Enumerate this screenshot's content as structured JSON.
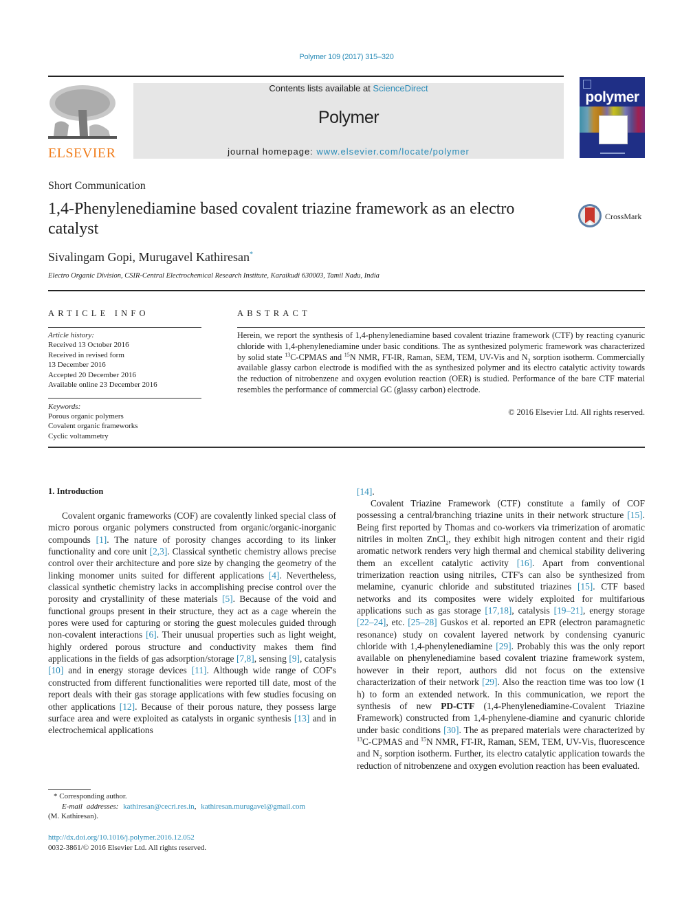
{
  "header": {
    "citation": "Polymer 109 (2017) 315–320",
    "contents_prefix": "Contents lists available at ",
    "contents_link": "ScienceDirect",
    "journal_name": "Polymer",
    "homepage_prefix": "journal homepage: ",
    "homepage_link": "www.elsevier.com/locate/polymer",
    "publisher_logo": "ELSEVIER",
    "cover_title": "polymer",
    "colors": {
      "link": "#2a8cb8",
      "elsevier_orange": "#f07c1a",
      "masthead_bg": "#e6e6e6",
      "cover_bg": "#1f2f86"
    }
  },
  "article": {
    "type": "Short Communication",
    "title": "1,4-Phenylenediamine based covalent triazine framework as an electro catalyst",
    "crossmark_label": "CrossMark",
    "authors": "Sivalingam Gopi, Murugavel Kathiresan",
    "author_mark": "*",
    "affiliation": "Electro Organic Division, CSIR-Central Electrochemical Research Institute, Karaikudi 630003, Tamil Nadu, India"
  },
  "article_info": {
    "heading": "ARTICLE INFO",
    "history_label": "Article history:",
    "history": [
      "Received 13 October 2016",
      "Received in revised form",
      "13 December 2016",
      "Accepted 20 December 2016",
      "Available online 23 December 2016"
    ],
    "keywords_label": "Keywords:",
    "keywords": [
      "Porous organic polymers",
      "Covalent organic frameworks",
      "Cyclic voltammetry"
    ]
  },
  "abstract": {
    "heading": "ABSTRACT",
    "p1": "Herein, we report the synthesis of 1,4-phenylenediamine based covalent triazine framework (CTF) by reacting cyanuric chloride with 1,4-phenylenediamine under basic conditions. The as synthesized polymeric framework was characterized by solid state ",
    "sup1": "13",
    "p2": "C-CPMAS and ",
    "sup2": "15",
    "p3": "N NMR, FT-IR, Raman, SEM, TEM, UV-Vis and N",
    "sub1": "2",
    "p4": " sorption isotherm. Commercially available glassy carbon electrode is modified with the as synthesized polymer and its electro catalytic activity towards the reduction of nitrobenzene and oxygen evolution reaction (OER) is studied. Performance of the bare CTF material resembles the performance of commercial GC (glassy carbon) electrode.",
    "copyright": "© 2016 Elsevier Ltd. All rights reserved."
  },
  "introduction": {
    "heading": "1.  Introduction",
    "left": [
      {
        "t": "Covalent organic frameworks (COF) are covalently linked special class of micro porous organic polymers constructed from organic/organic-inorganic compounds "
      },
      {
        "ref": "[1]"
      },
      {
        "t": ". The nature of porosity changes according to its linker functionality and core unit "
      },
      {
        "ref": "[2,3]"
      },
      {
        "t": ". Classical synthetic chemistry allows precise control over their architecture and pore size by changing the geometry of the linking monomer units suited for different applications "
      },
      {
        "ref": "[4]"
      },
      {
        "t": ". Nevertheless, classical synthetic chemistry lacks in accomplishing precise control over the porosity and crystallinity of these materials "
      },
      {
        "ref": "[5]"
      },
      {
        "t": ". Because of the void and functional groups present in their structure, they act as a cage wherein the pores were used for capturing or storing the guest molecules guided through non-covalent interactions "
      },
      {
        "ref": "[6]"
      },
      {
        "t": ". Their unusual properties such as light weight, highly ordered porous structure and conductivity makes them find applications in the fields of gas adsorption/storage "
      },
      {
        "ref": "[7,8]"
      },
      {
        "t": ", sensing "
      },
      {
        "ref": "[9]"
      },
      {
        "t": ", catalysis "
      },
      {
        "ref": "[10]"
      },
      {
        "t": " and in energy storage devices "
      },
      {
        "ref": "[11]"
      },
      {
        "t": ". Although wide range of COF's constructed from different functionalities were reported till date, most of the report deals with their gas storage applications with few studies focusing on other applications "
      },
      {
        "ref": "[12]"
      },
      {
        "t": ". Because of their porous nature, they possess large surface area and were exploited as catalysts in organic synthesis "
      },
      {
        "ref": "[13]"
      },
      {
        "t": " and in electrochemical applications"
      }
    ],
    "right_continuation": [
      {
        "ref": "[14]"
      },
      {
        "t": "."
      }
    ],
    "right": [
      {
        "t": "Covalent Triazine Framework (CTF) constitute a family of COF possessing a central/branching triazine units in their network structure "
      },
      {
        "ref": "[15]"
      },
      {
        "t": ". Being first reported by Thomas and co-workers via trimerization of aromatic nitriles in molten ZnCl"
      },
      {
        "sub": "2"
      },
      {
        "t": ", they exhibit high nitrogen content and their rigid aromatic network renders very high thermal and chemical stability delivering them an excellent catalytic activity "
      },
      {
        "ref": "[16]"
      },
      {
        "t": ". Apart from conventional trimerization reaction using nitriles, CTF's can also be synthesized from melamine, cyanuric chloride and substituted triazines "
      },
      {
        "ref": "[15]"
      },
      {
        "t": ". CTF based networks and its composites were widely exploited for multifarious applications such as gas storage "
      },
      {
        "ref": "[17,18]"
      },
      {
        "t": ", catalysis "
      },
      {
        "ref": "[19–21]"
      },
      {
        "t": ", energy storage "
      },
      {
        "ref": "[22–24]"
      },
      {
        "t": ", etc. "
      },
      {
        "ref": "[25–28]"
      },
      {
        "t": " Guskos et al. reported an EPR (electron paramagnetic resonance) study on covalent layered network by condensing cyanuric chloride with 1,4-phenylenediamine "
      },
      {
        "ref": "[29]"
      },
      {
        "t": ". Probably this was the only report available on phenylenediamine based covalent triazine framework system, however in their report, authors did not focus on the extensive characterization of their network "
      },
      {
        "ref": "[29]"
      },
      {
        "t": ". Also the reaction time was too low (1 h) to form an extended network. In this communication, we report the synthesis of new "
      },
      {
        "b": "PD-CTF"
      },
      {
        "t": " (1,4-Phenylenediamine-Covalent Triazine Framework) constructed from 1,4-phenylene-diamine and cyanuric chloride under basic conditions "
      },
      {
        "ref": "[30]"
      },
      {
        "t": ". The as prepared materials were characterized by "
      },
      {
        "sup": "13"
      },
      {
        "t": "C-CPMAS and "
      },
      {
        "sup": "15"
      },
      {
        "t": "N NMR, FT-IR, Raman, SEM, TEM, UV-Vis, fluorescence and N"
      },
      {
        "sub": "2"
      },
      {
        "t": " sorption isotherm. Further, its electro catalytic application towards the reduction of nitrobenzene and oxygen evolution reaction has been evaluated."
      }
    ]
  },
  "footnotes": {
    "corresponding": "* Corresponding author.",
    "email_label": "E-mail addresses:",
    "email_1": "kathiresan@cecri.res.in",
    "email_2": "kathiresan.murugavel@gmail.com",
    "email_owner": "(M. Kathiresan).",
    "doi": "http://dx.doi.org/10.1016/j.polymer.2016.12.052",
    "issn_line": "0032-3861/© 2016 Elsevier Ltd. All rights reserved."
  }
}
